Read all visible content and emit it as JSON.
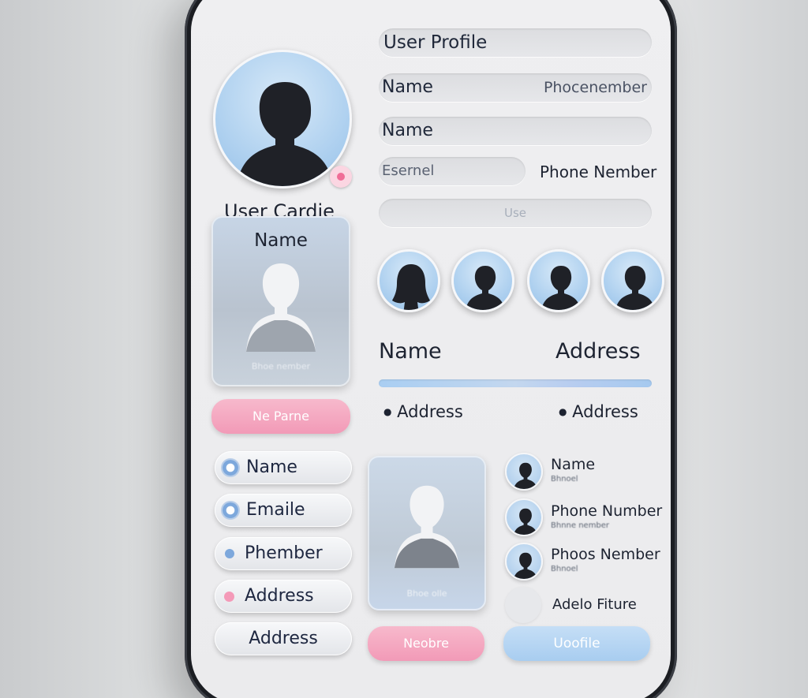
{
  "header": {
    "title": "User Profile",
    "field_name": "Name",
    "field_phone": "Phocenember",
    "field_name2": "Name",
    "field_email": "Esernel",
    "field_phone2": "Phone Nember",
    "field_user": "Use"
  },
  "profile": {
    "name": "User Cardie"
  },
  "card1": {
    "title": "Name",
    "caption": "Bhoe nember"
  },
  "pink_button1": "Ne Parne",
  "list_items": [
    {
      "label": "Name",
      "dot": "blue"
    },
    {
      "label": "Emaile",
      "dot": "blue"
    },
    {
      "label": "Phember",
      "dot": "blue-small"
    },
    {
      "label": "Address",
      "dot": "pink"
    },
    {
      "label": "Address",
      "dot": "none"
    }
  ],
  "name_address": {
    "name_label": "Name",
    "address_label": "Address",
    "bullet1": "Address",
    "bullet2": "Address"
  },
  "card2": {
    "caption": "Bhoe olle"
  },
  "contacts": [
    {
      "name": "Name",
      "sub": "Bhnoel"
    },
    {
      "name": "Phone Number",
      "sub": "Bhnne nember"
    },
    {
      "name": "Phoos Nember",
      "sub": "Bhnoel"
    }
  ],
  "picture_label": "Adelo Fiture",
  "pink_button2": "Neobre",
  "blue_button": "Uoofile",
  "colors": {
    "accent_blue": "#a8cdf0",
    "accent_pink": "#f29ab7",
    "badge_pink": "#f06d97"
  }
}
